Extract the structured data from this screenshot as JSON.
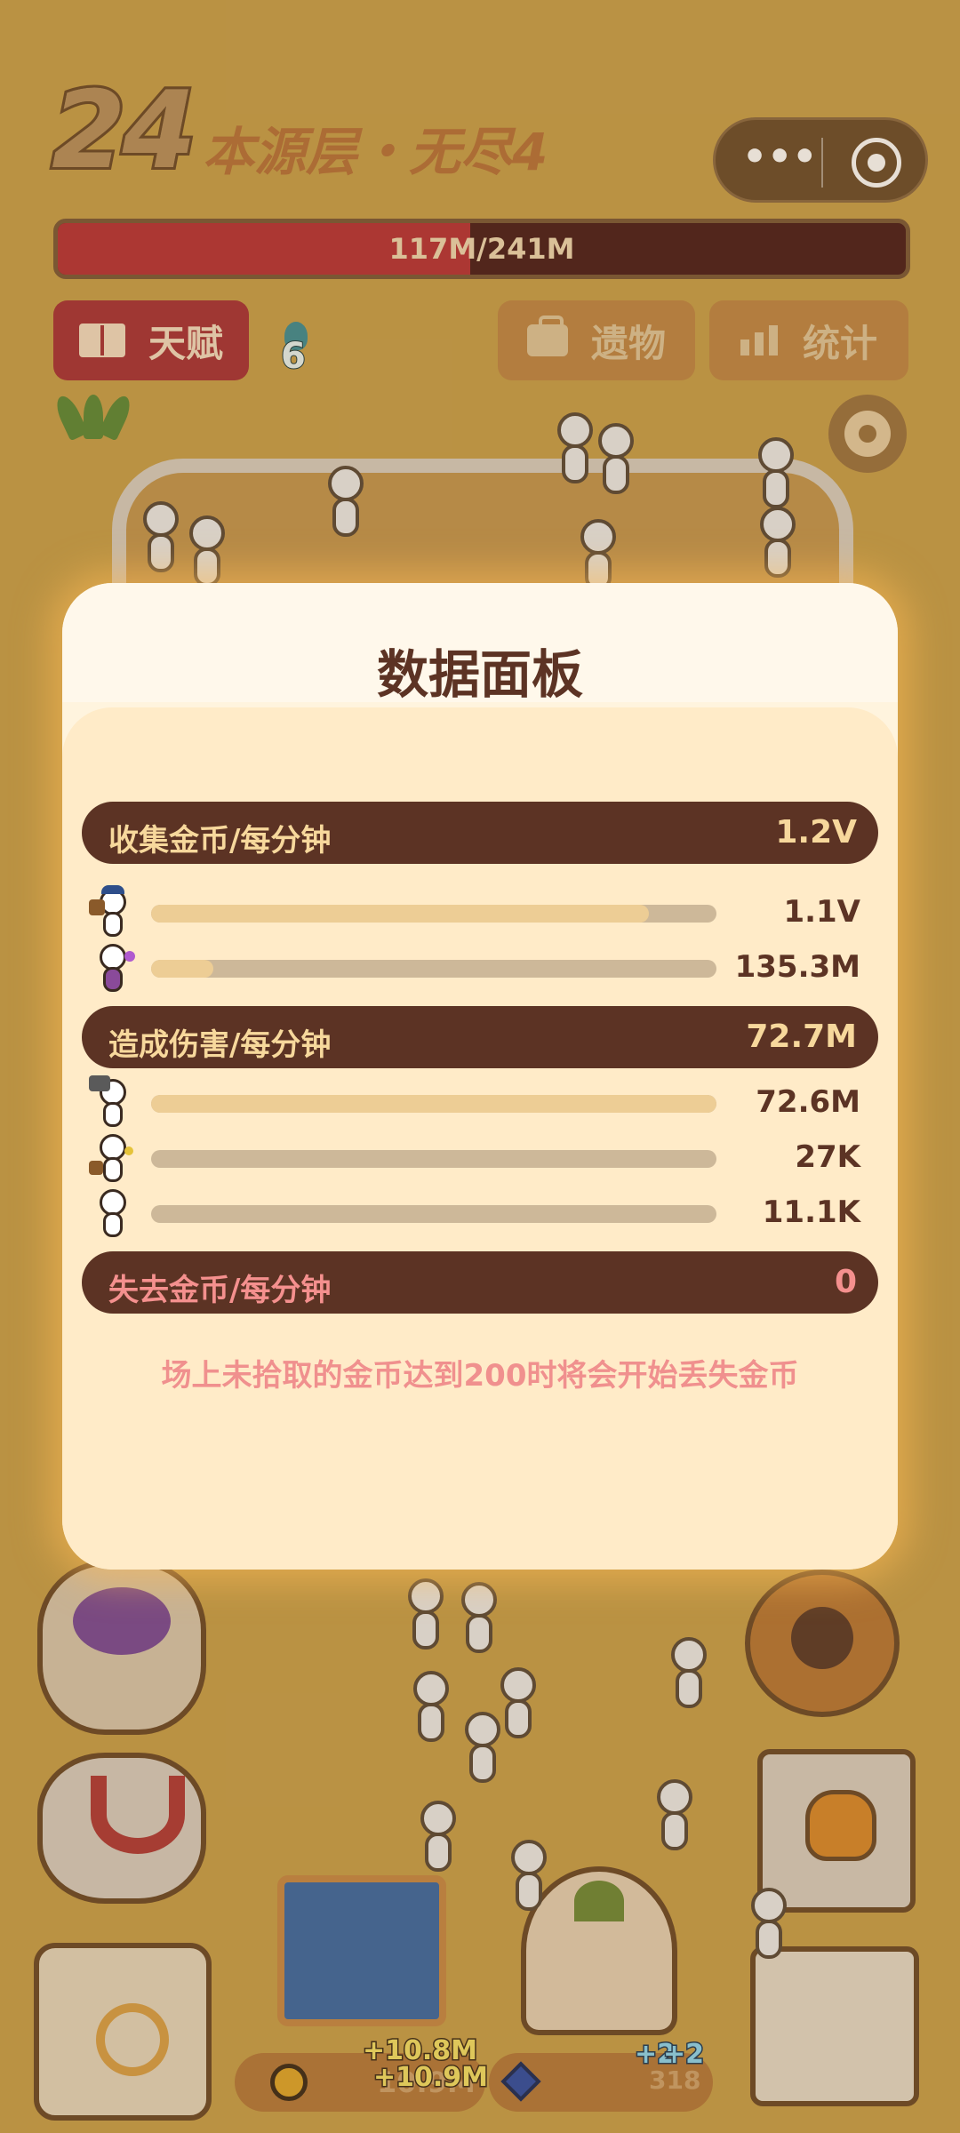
{
  "hud": {
    "level_number": "24",
    "level_title": "本源层・无尽4",
    "boss_hp_text": "117M/241M",
    "boss_hp_fraction": 0.486,
    "talent_label": "天赋",
    "talent_points": "6",
    "relic_label": "遗物",
    "stats_label": "统计",
    "menu_icon": "more-dots-icon",
    "close_icon": "target-close-icon",
    "settings_icon": "gear-icon"
  },
  "resources": {
    "gold_gain_a": "+10.8M",
    "gold_gain_b": "+10.9M",
    "gold_total": "10.9M",
    "gem_gain_a": "+2",
    "gem_gain_b": "+2",
    "gem_total": "318"
  },
  "panel": {
    "title": "数据面板",
    "sections": {
      "collect": {
        "label": "收集金币/每分钟",
        "value": "1.2V",
        "rows": [
          {
            "icon": "backpack-worker-icon",
            "value": "1.1V",
            "fraction": 0.88
          },
          {
            "icon": "wizard-icon",
            "value": "135.3M",
            "fraction": 0.11
          }
        ]
      },
      "damage": {
        "label": "造成伤害/每分钟",
        "value": "72.7M",
        "rows": [
          {
            "icon": "hammer-warrior-icon",
            "value": "72.6M",
            "fraction": 1.0
          },
          {
            "icon": "torch-unit-icon",
            "value": "27K",
            "fraction": 0.0
          },
          {
            "icon": "plain-unit-icon",
            "value": "11.1K",
            "fraction": 0.0
          }
        ]
      },
      "loss": {
        "label": "失去金币/每分钟",
        "value": "0"
      }
    },
    "notice": "场上未拾取的金币达到200时将会开始丢失金币"
  },
  "colors": {
    "panel_bg": "#FFF4DE",
    "section_bar": "#5C3324",
    "section_text": "#F7D89C",
    "loss_text": "#F4908E",
    "hp_fill": "#B8333A",
    "talent_button": "#A8333A",
    "tab_button": "#C08848"
  }
}
